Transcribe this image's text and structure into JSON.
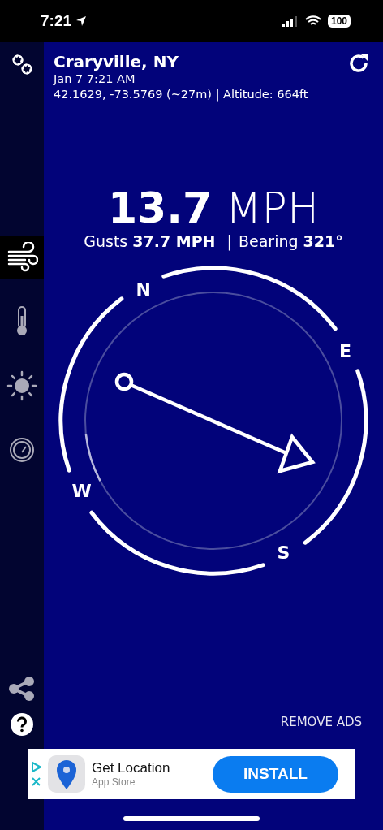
{
  "status_bar": {
    "time": "7:21",
    "battery": "100"
  },
  "header": {
    "location": "Craryville, NY",
    "datetime": "Jan 7 7:21 AM",
    "coordinates": "42.1629, -73.5769 (~27m) | Altitude: 664ft"
  },
  "sidebar": {
    "items": [
      {
        "kind": "wind",
        "selected": true
      },
      {
        "kind": "thermometer",
        "selected": false
      },
      {
        "kind": "sun",
        "selected": false
      },
      {
        "kind": "gauge",
        "selected": false
      }
    ]
  },
  "speed": {
    "value": "13.7",
    "unit": "MPH"
  },
  "details": {
    "gusts_label": "Gusts",
    "gusts_value": "37.7 MPH",
    "separator": "|",
    "bearing_label": "Bearing",
    "bearing_value": "321°"
  },
  "compass": {
    "labels": [
      "N",
      "E",
      "S",
      "W"
    ]
  },
  "remove_ads": "REMOVE ADS",
  "ad": {
    "title": "Get Location",
    "subtitle": "App Store",
    "button": "INSTALL"
  }
}
